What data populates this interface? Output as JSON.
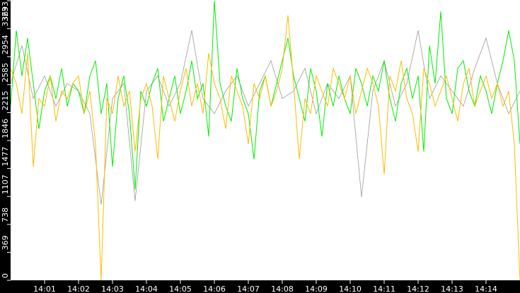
{
  "chart_data": {
    "type": "line",
    "title": "",
    "xlabel": "",
    "ylabel": "",
    "x_range": [
      "14:00",
      "14:15"
    ],
    "ylim": [
      0,
      3693
    ],
    "grid": false,
    "legend": "none",
    "y_ticks": [
      "0",
      "369",
      "738",
      "1107",
      "1477",
      "1846",
      "2215",
      "2585",
      "2954",
      "3323",
      "3693"
    ],
    "y_tick_values": [
      0,
      369,
      738,
      1107,
      1477,
      1846,
      2215,
      2585,
      2954,
      3323,
      3693
    ],
    "x_ticks": [
      "14:01",
      "14:02",
      "14:03",
      "14:04",
      "14:05",
      "14:06",
      "14:07",
      "14:08",
      "14:09",
      "14:10",
      "14:11",
      "14:12",
      "14:13",
      "14:14"
    ],
    "x_tick_minutes": [
      1,
      2,
      3,
      4,
      5,
      6,
      7,
      8,
      9,
      10,
      11,
      12,
      13,
      14
    ],
    "series": [
      {
        "name": "gray",
        "color": "#9a9a9a",
        "values": [
          2600,
          3100,
          2400,
          2700,
          2300,
          2600,
          2500,
          2200,
          1000,
          2400,
          2600,
          1050,
          2500,
          2700,
          2300,
          2600,
          3300,
          2400,
          2200,
          2500,
          2700,
          2300,
          2600,
          2900,
          2400,
          2500,
          2800,
          2200,
          2600,
          2400,
          2700,
          1100,
          2500,
          2900,
          2300,
          2600,
          3300,
          2400,
          2700,
          2500,
          2300,
          2800,
          3200,
          2600,
          2200,
          2500
        ]
      },
      {
        "name": "green",
        "color": "#00ee00",
        "values": [
          2300,
          3300,
          2700,
          3200,
          2600,
          2000,
          2500,
          2700,
          2400,
          2800,
          2300,
          2600,
          2500,
          2200,
          2700,
          2900,
          2200,
          2600,
          1500,
          2400,
          2700,
          2200,
          1200,
          2500,
          2300,
          2600,
          2800,
          2100,
          2400,
          2700,
          2200,
          2500,
          2900,
          2400,
          2600,
          1900,
          3693,
          2600,
          2300,
          2100,
          2800,
          2400,
          2200,
          1600,
          2500,
          2700,
          2300,
          2600,
          2900,
          3200,
          2700,
          2400,
          2100,
          2800,
          2500,
          1900,
          2600,
          2300,
          2700,
          2400,
          2200,
          2800,
          2600,
          2300,
          2700,
          2500,
          2900,
          2400,
          2100,
          2600,
          2800,
          2400,
          2700,
          1700,
          3100,
          2600,
          3550,
          2400,
          2200,
          2800,
          2900,
          2500,
          2300,
          2700,
          2500,
          2200,
          2600,
          2900,
          3300,
          2900,
          1800
        ]
      },
      {
        "name": "orange",
        "color": "#ffbb00",
        "values": [
          2800,
          2600,
          2200,
          3000,
          1500,
          2400,
          2300,
          2700,
          2100,
          2500,
          2400,
          2600,
          2700,
          2200,
          2500,
          1800,
          0,
          2400,
          2200,
          2700,
          2300,
          2500,
          1700,
          2400,
          2600,
          2300,
          1600,
          2700,
          2400,
          2100,
          2500,
          2800,
          2300,
          2600,
          2200,
          3000,
          2600,
          2400,
          2000,
          2700,
          2500,
          2300,
          1800,
          2600,
          2400,
          2700,
          2300,
          2500,
          2800,
          3500,
          2600,
          1600,
          2400,
          2200,
          2700,
          2500,
          2300,
          2800,
          2600,
          2400,
          2700,
          2200,
          2500,
          2800,
          2600,
          2300,
          1400,
          2700,
          2500,
          2900,
          2400,
          2200,
          1700,
          2800,
          2600,
          2300,
          2500,
          2700,
          2400,
          2100,
          2600,
          2800,
          2300,
          2500,
          2700,
          2400,
          2600,
          2300,
          2500,
          1800,
          0
        ]
      }
    ]
  }
}
